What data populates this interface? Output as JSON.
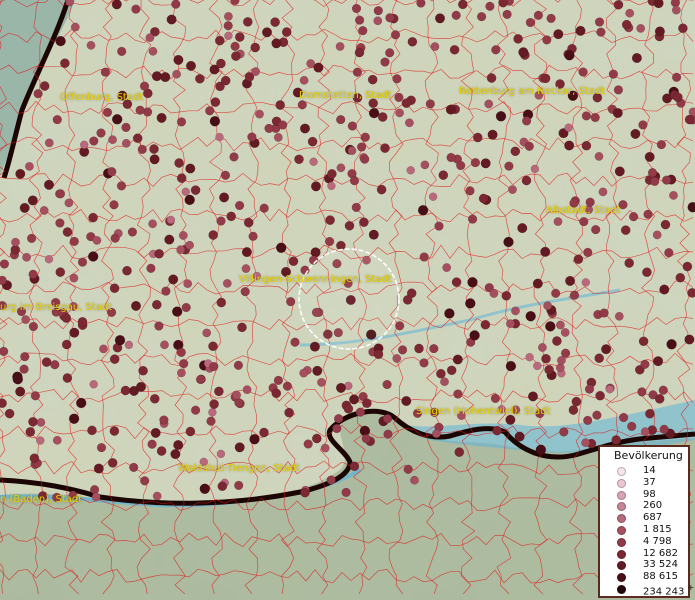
{
  "cities": [
    {
      "name": "Offenburg, Stadt"
    },
    {
      "name": "Dornstetten, Stadt"
    },
    {
      "name": "Rottenburg am Neckar, Stadt"
    },
    {
      "name": "Albstadt, Stadt"
    },
    {
      "name": "Villingen-Schwenningen, Stadt"
    },
    {
      "name": "urg im Breisgau, Stadt"
    },
    {
      "name": "Singen (Hohentwiel), Stadt"
    },
    {
      "name": "Waldshut-Tiengen, Stadt"
    },
    {
      "name": "n (Baden), Stadt"
    }
  ],
  "legend": {
    "title": "Bevölkerung",
    "items": [
      {
        "label": "14",
        "color": "#f6e3ec"
      },
      {
        "label": "37",
        "color": "#ebc6d2"
      },
      {
        "label": "98",
        "color": "#d8a3b2"
      },
      {
        "label": "260",
        "color": "#c98595"
      },
      {
        "label": "687",
        "color": "#b9697b"
      },
      {
        "label": "1 815",
        "color": "#a6505f"
      },
      {
        "label": "4 798",
        "color": "#923a47"
      },
      {
        "label": "12 682",
        "color": "#7b2833"
      },
      {
        "label": "33 524",
        "color": "#631a23"
      },
      {
        "label": "88 615",
        "color": "#4a0f16"
      },
      {
        "label": "234 243",
        "color": "#26070a",
        "suffix": "+"
      }
    ]
  },
  "colors": {
    "boundary": "#e01818",
    "label": "#e6d200",
    "water": "#5fb4d8",
    "border": "#1b0604"
  }
}
